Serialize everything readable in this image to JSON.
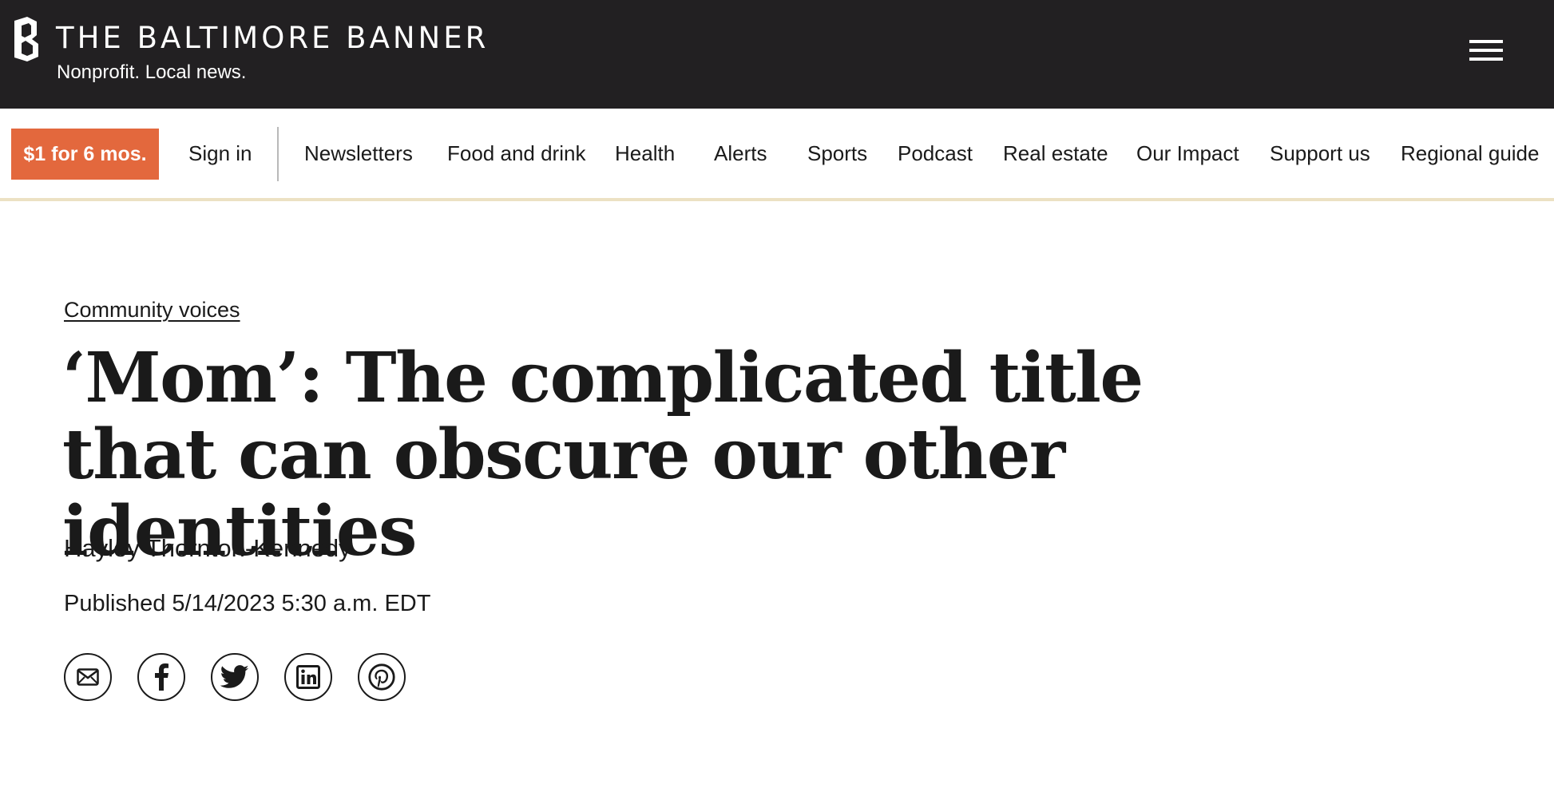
{
  "masthead": {
    "brand": "THE BALTIMORE BANNER",
    "tagline": "Nonprofit. Local news.",
    "background_color": "#222022",
    "logo_icon": "banner-b-logo-icon",
    "menu_icon": "hamburger-menu-icon"
  },
  "navbar": {
    "subscribe_label": "$1 for 6 mos.",
    "subscribe_color": "#e3683d",
    "signin_label": "Sign in",
    "items": [
      {
        "label": "Newsletters"
      },
      {
        "label": "Food and drink"
      },
      {
        "label": "Health"
      },
      {
        "label": "Alerts"
      },
      {
        "label": "Sports"
      },
      {
        "label": "Podcast"
      },
      {
        "label": "Real estate"
      },
      {
        "label": "Our Impact"
      },
      {
        "label": "Support us"
      },
      {
        "label": "Regional guide"
      }
    ],
    "border_color": "#ece1c3"
  },
  "article": {
    "section": "Community voices",
    "headline": "‘Mom’: The complicated title that can obscure our other identities",
    "author": "Hayley Thornton-Kennedy",
    "published": "Published 5/14/2023 5:30 a.m. EDT"
  },
  "share": [
    {
      "icon": "email-icon"
    },
    {
      "icon": "facebook-icon"
    },
    {
      "icon": "twitter-icon"
    },
    {
      "icon": "linkedin-icon"
    },
    {
      "icon": "pinterest-icon"
    }
  ]
}
